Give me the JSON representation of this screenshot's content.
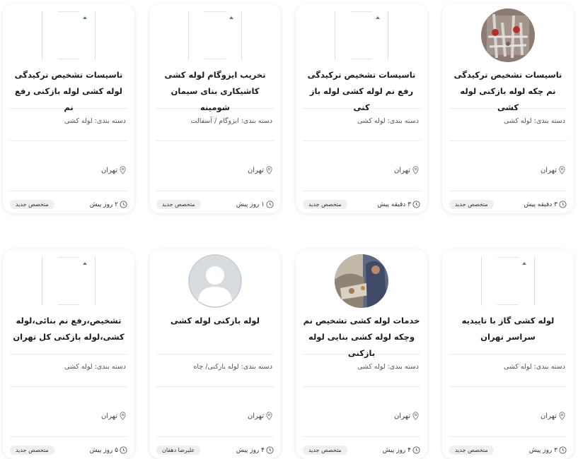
{
  "cards": [
    {
      "avatar": "photo-plumbing-pipes",
      "title": "تاسیسات تشخیص ترکیدگی نم چکه لوله بازکنی لوله کشی",
      "category": "دسته بندی: لوله کشی",
      "location": "تهران",
      "time": "۳ دقیقه پیش",
      "badge": "متخصص جدید"
    },
    {
      "avatar": "broken-image",
      "title": "تاسیسات تشخیص ترکیدگی رفع نم لوله کشی لوله باز کنی",
      "category": "دسته بندی: لوله کشی",
      "location": "تهران",
      "time": "۳ دقیقه پیش",
      "badge": "متخصص جدید"
    },
    {
      "avatar": "broken-image",
      "title": "تخریب ایزوگام لوله کشی کاشیکاری بنای سیمان شومینه",
      "category": "دسته بندی: ایزوگام / آسفالت",
      "location": "تهران",
      "time": "۱ روز پیش",
      "badge": "متخصص جدید"
    },
    {
      "avatar": "broken-image",
      "title": "تاسیسات تشخیص ترکیدگی لوله کشی لوله بازکنی رفع نم",
      "category": "دسته بندی: لوله کشی",
      "location": "تهران",
      "time": "۲ روز پیش",
      "badge": "متخصص جدید"
    },
    {
      "avatar": "broken-image",
      "title": "لوله کشی گاز با تاییدیه سراسر تهران",
      "category": "دسته بندی: لوله کشی",
      "location": "تهران",
      "time": "۳ روز پیش",
      "badge": "متخصص جدید"
    },
    {
      "avatar": "photo-worker",
      "title": "خدمات لوله کشی تشخیص نم وچکه لوله کشی بنایی لوله بازکنی",
      "category": "دسته بندی: لوله کشی",
      "location": "تهران",
      "time": "۴ روز پیش",
      "badge": "متخصص جدید"
    },
    {
      "avatar": "default-user",
      "title": "لوله بازکنی لوله کشی",
      "category": "دسته بندی: لوله بازکنی/ چاه",
      "location": "تهران",
      "time": "۴ روز پیش",
      "badge": "علیرضا دهقان"
    },
    {
      "avatar": "broken-image",
      "title": "تشخیص،رفع نم بنائی،لوله کشی،لوله بازکنی کل تهران",
      "category": "دسته بندی: لوله کشی",
      "location": "تهران",
      "time": "۵ روز پیش",
      "badge": "متخصص جدید"
    }
  ],
  "colors": {
    "card_bg": "#ffffff",
    "badge_bg": "#efefef",
    "text_primary": "#1c1c1c",
    "text_secondary": "#555555"
  }
}
